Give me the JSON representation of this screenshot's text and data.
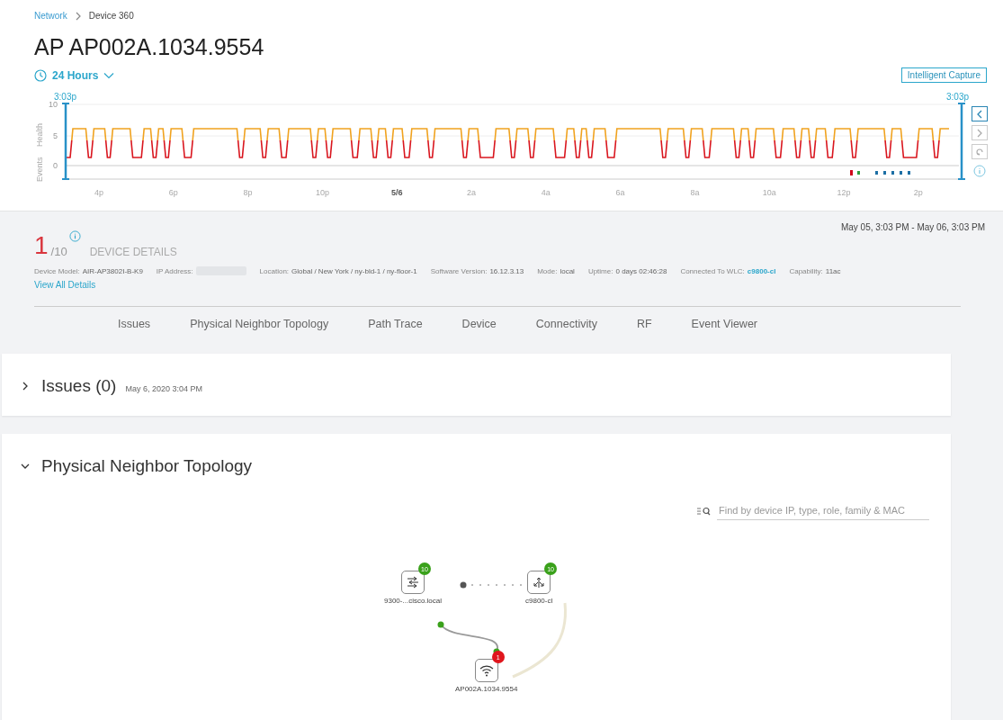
{
  "breadcrumb": [
    {
      "label": "Network",
      "kind": "link"
    },
    {
      "label": "Device 360",
      "kind": "current"
    }
  ],
  "title": "AP AP002A.1034.9554",
  "time_range": {
    "label": "24 Hours"
  },
  "intelligent_capture_button": "Intelligent Capture",
  "timeline": {
    "start_marker": "3:03p",
    "end_marker": "3:03p",
    "y_ticks": [
      "10",
      "5",
      "0"
    ],
    "y_labels": [
      "Events",
      "Health"
    ],
    "x_ticks": [
      {
        "label": "4p",
        "bold": false
      },
      {
        "label": "6p",
        "bold": false
      },
      {
        "label": "8p",
        "bold": false
      },
      {
        "label": "10p",
        "bold": false
      },
      {
        "label": "5/6",
        "bold": true
      },
      {
        "label": "2a",
        "bold": false
      },
      {
        "label": "4a",
        "bold": false
      },
      {
        "label": "6a",
        "bold": false
      },
      {
        "label": "8a",
        "bold": false
      },
      {
        "label": "10a",
        "bold": false
      },
      {
        "label": "12p",
        "bold": false
      },
      {
        "label": "2p",
        "bold": false
      }
    ],
    "events": [
      {
        "color": "#d0021b"
      },
      {
        "color": "#2e9e3e"
      },
      {
        "color": "#1d6fa5"
      },
      {
        "color": "#1d6fa5"
      },
      {
        "color": "#1d6fa5"
      },
      {
        "color": "#1d6fa5"
      },
      {
        "color": "#1d6fa5"
      }
    ]
  },
  "date_range": "May 05, 3:03 PM - May 06, 3:03 PM",
  "health": {
    "score": "1",
    "out_of": "/10"
  },
  "device_details_label": "DEVICE DETAILS",
  "details": [
    {
      "label": "Device Model:",
      "value": "AIR-AP3802I-B-K9",
      "kind": "text"
    },
    {
      "label": "IP Address:",
      "kind": "hidden"
    },
    {
      "label": "Location:",
      "value": "Global / New York / ny-bld-1 / ny-floor-1",
      "kind": "text"
    },
    {
      "label": "Software Version:",
      "value": "16.12.3.13",
      "kind": "text"
    },
    {
      "label": "Mode:",
      "value": "local",
      "kind": "text"
    },
    {
      "label": "Uptime:",
      "value": "0 days 02:46:28",
      "kind": "text"
    },
    {
      "label": "Connected To WLC:",
      "value": "c9800-cl",
      "kind": "link"
    },
    {
      "label": "Capability:",
      "value": "11ac",
      "kind": "text"
    }
  ],
  "view_all_link": "View All Details",
  "tabs": [
    {
      "label": "Issues",
      "selected": false
    },
    {
      "label": "Physical Neighbor Topology",
      "selected": false
    },
    {
      "label": "Path Trace",
      "selected": false
    },
    {
      "label": "Device",
      "selected": false
    },
    {
      "label": "Connectivity",
      "selected": false
    },
    {
      "label": "RF",
      "selected": false
    },
    {
      "label": "Event Viewer",
      "selected": false
    }
  ],
  "sections": [
    {
      "title": "Issues (0)",
      "subtitle": "May 6, 2020 3:04 PM",
      "expanded": false
    },
    {
      "title": "Physical Neighbor Topology",
      "expanded": true
    }
  ],
  "topology": {
    "search": {
      "placeholder": "Find by device IP, type, role, family & MAC"
    },
    "nodes": [
      {
        "kind": "switch",
        "label": "9300-...cisco.local",
        "badge": "10",
        "color": "#3aa11b"
      },
      {
        "kind": "controller",
        "label": "c9800-cl",
        "badge": "10",
        "color": "#3aa11b"
      },
      {
        "kind": "ap",
        "label": "AP002A.1034.9554",
        "badge": "1",
        "color": "#e0161d"
      }
    ]
  }
}
